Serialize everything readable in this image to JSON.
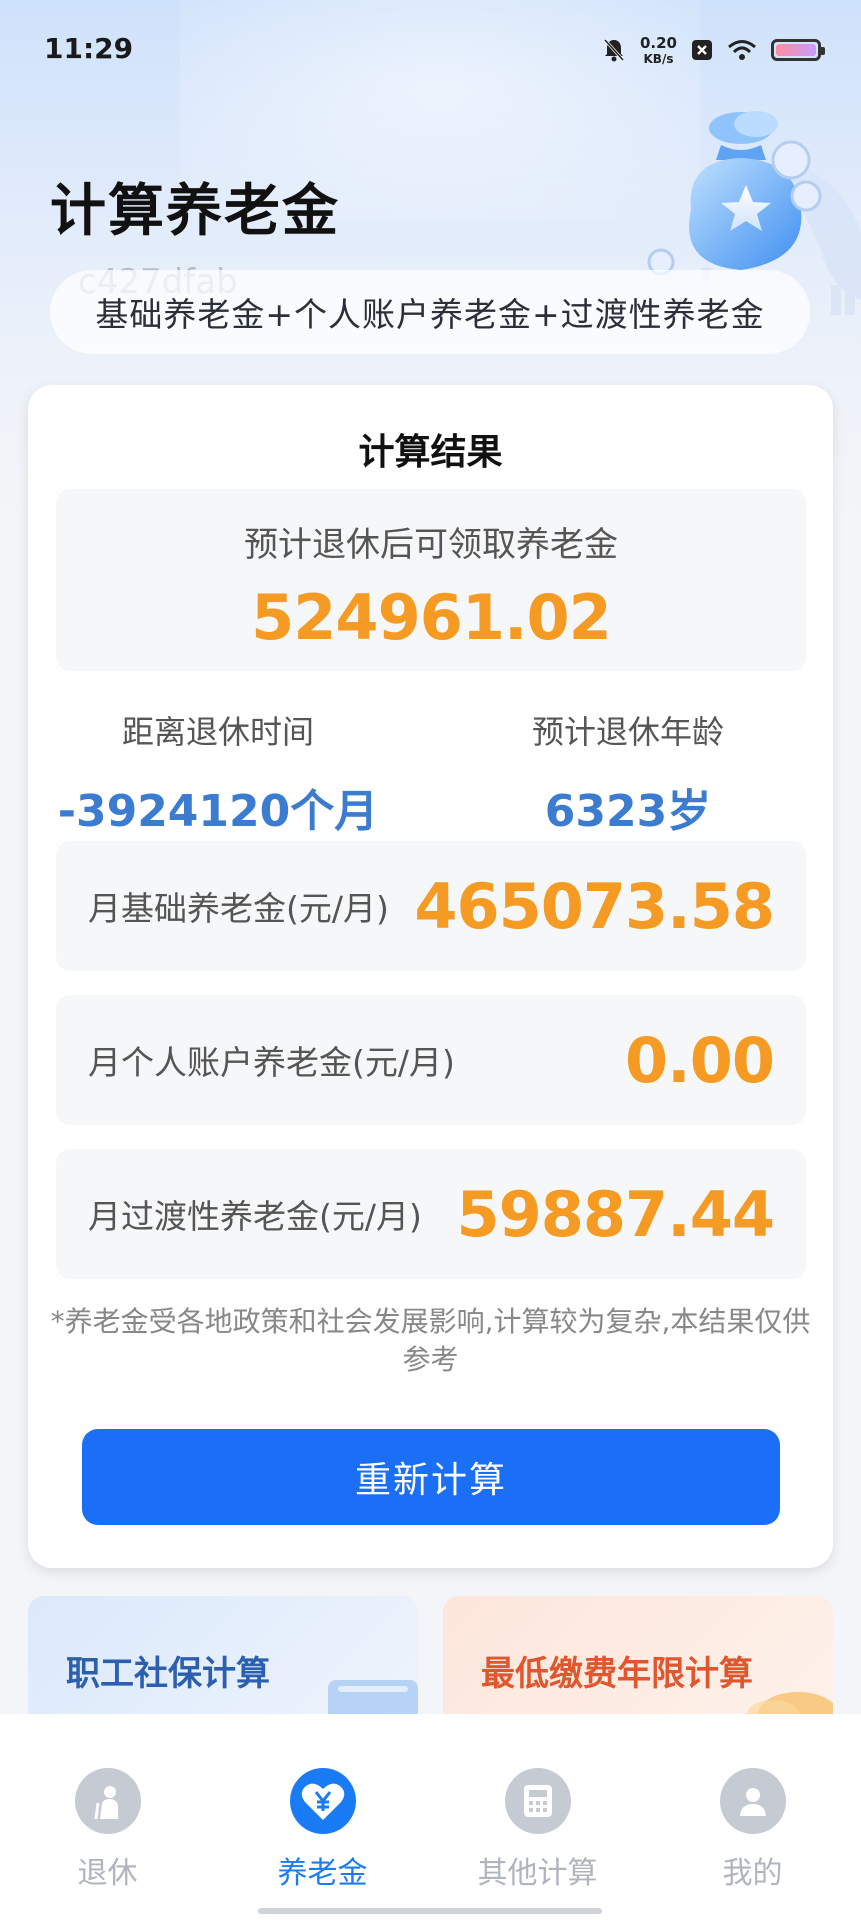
{
  "status_bar": {
    "time": "11:29",
    "net_speed_value": "0.20",
    "net_speed_unit": "KB/s",
    "icons": [
      "bell-muted-icon",
      "net-speed-icon",
      "x-badge-icon",
      "wifi-icon",
      "battery-icon"
    ]
  },
  "header": {
    "title": "计算养老金",
    "formula": "基础养老金+个人账户养老金+过渡性养老金",
    "watermark": "c427dfab"
  },
  "result": {
    "title": "计算结果",
    "total_label": "预计退休后可领取养老金",
    "total_value": "524961.02",
    "time_to_retire_label": "距离退休时间",
    "time_to_retire_value": "-3924120个月",
    "retire_age_label": "预计退休年龄",
    "retire_age_value": "6323岁",
    "rows": [
      {
        "label": "月基础养老金(元/月)",
        "value": "465073.58"
      },
      {
        "label": "月个人账户养老金(元/月)",
        "value": "0.00"
      },
      {
        "label": "月过渡性养老金(元/月)",
        "value": "59887.44"
      }
    ],
    "disclaimer": "*养老金受各地政策和社会发展影响,计算较为复杂,本结果仅供参考",
    "recalc_label": "重新计算"
  },
  "promos": [
    {
      "label": "职工社保计算"
    },
    {
      "label": "最低缴费年限计算"
    }
  ],
  "tabs": [
    {
      "label": "退休",
      "icon": "retire-person-icon",
      "active": false
    },
    {
      "label": "养老金",
      "icon": "pension-yen-heart-icon",
      "active": true
    },
    {
      "label": "其他计算",
      "icon": "calculator-icon",
      "active": false
    },
    {
      "label": "我的",
      "icon": "profile-icon",
      "active": false
    }
  ],
  "colors": {
    "accent_blue": "#1a6ff6",
    "value_orange": "#f59a23",
    "info_blue": "#3b7bd0"
  }
}
